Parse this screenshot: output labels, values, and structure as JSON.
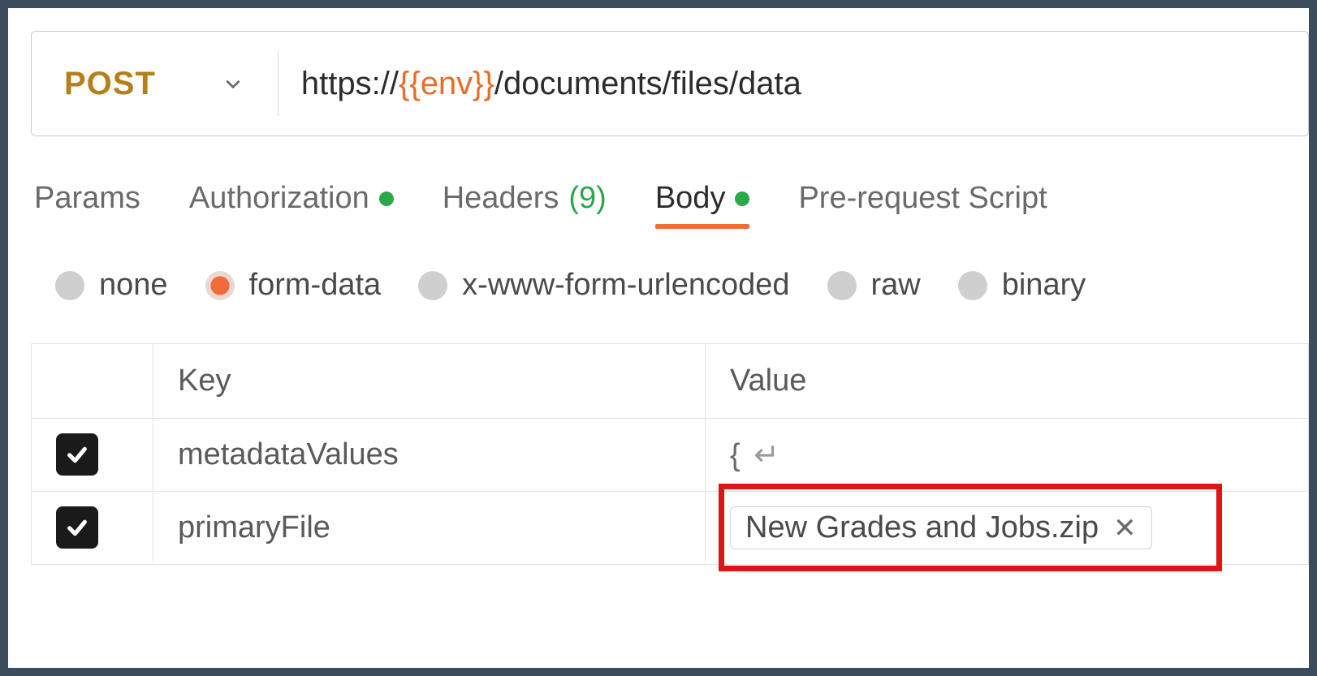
{
  "request": {
    "method": "POST",
    "url_prefix": "https://",
    "url_var": "{{env}}",
    "url_suffix": "/documents/files/data"
  },
  "tabs": {
    "params": "Params",
    "authorization": "Authorization",
    "headers_label": "Headers",
    "headers_count": "(9)",
    "body": "Body",
    "prerequest": "Pre-request Script"
  },
  "body_types": {
    "none": "none",
    "form_data": "form-data",
    "urlencoded": "x-www-form-urlencoded",
    "raw": "raw",
    "binary": "binary"
  },
  "table": {
    "headers": {
      "key": "Key",
      "value": "Value"
    },
    "rows": [
      {
        "checked": true,
        "key": "metadataValues",
        "value": "{",
        "is_file": false
      },
      {
        "checked": true,
        "key": "primaryFile",
        "value": "New Grades and Jobs.zip",
        "is_file": true
      }
    ]
  }
}
